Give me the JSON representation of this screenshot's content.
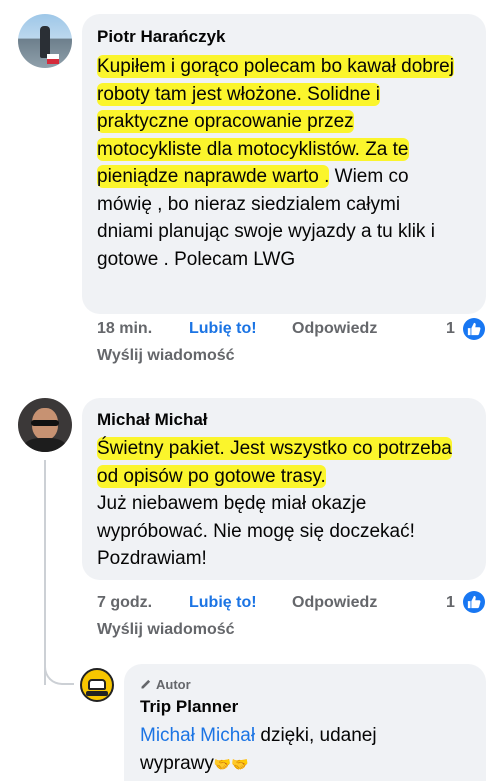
{
  "comments": [
    {
      "author": "Piotr Harańczyk",
      "text_highlighted": "Kupiłem i gorąco polecam bo kawał dobrej roboty tam jest włożone. Solidne  i praktyczne opracowanie przez motocykliste dla motocyklistów. Za te pieniądze naprawde warto .",
      "text_plain": " Wiem co mówię , bo nieraz siedzialem całymi dniami planując swoje wyjazdy a tu klik i gotowe . Polecam LWG",
      "time": "18 min.",
      "like_label": "Lubię to!",
      "reply_label": "Odpowiedz",
      "message_label": "Wyślij wiadomość",
      "reaction_count": "1"
    },
    {
      "author": "Michał Michał",
      "text_highlighted": "Świetny pakiet. Jest wszystko co potrzeba od opisów po gotowe trasy.",
      "text_plain": "Już niebawem będę miał okazje wypróbować. Nie mogę się doczekać! Pozdrawiam!",
      "time": "7 godz.",
      "like_label": "Lubię to!",
      "reply_label": "Odpowiedz",
      "message_label": "Wyślij wiadomość",
      "reaction_count": "1"
    }
  ],
  "reply": {
    "badge": "Autor",
    "author": "Trip Planner",
    "mention": "Michał Michał",
    "text": " dzięki, udanej wyprawy",
    "emoji": "🤝🤝"
  },
  "colors": {
    "highlight": "#fbf52c",
    "link_blue": "#1b74e4",
    "bubble_bg": "#f0f2f5",
    "meta_gray": "#65676b"
  },
  "icons": {
    "like_badge": "thumbs-up-icon",
    "author_badge": "pencil-icon"
  }
}
